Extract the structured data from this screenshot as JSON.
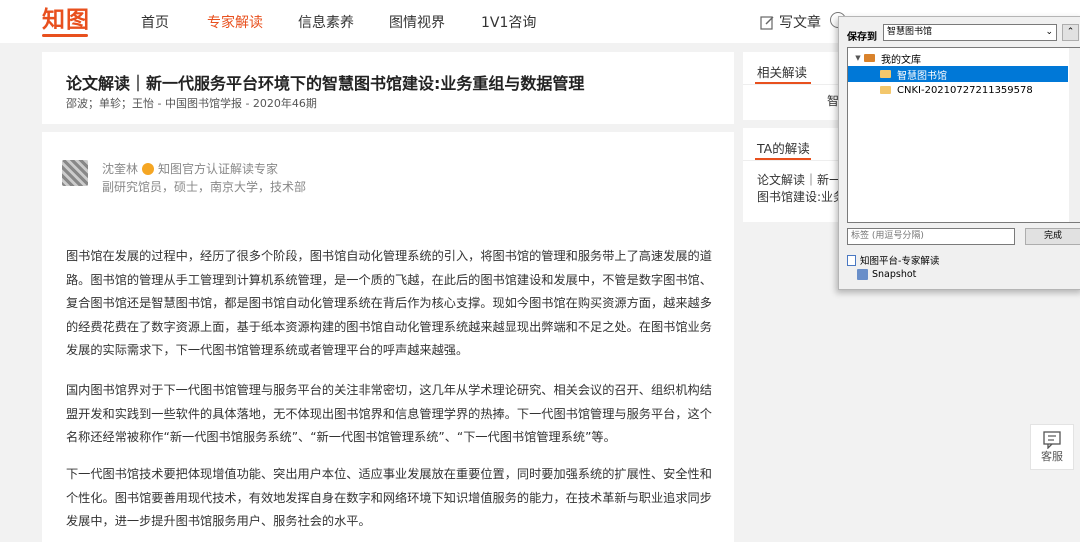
{
  "nav": {
    "logo": "知图",
    "items": [
      "首页",
      "专家解读",
      "信息素养",
      "图情视界",
      "1V1咨询"
    ],
    "active_index": 1,
    "write": "写文章"
  },
  "article": {
    "title": "论文解读｜新一代服务平台环境下的智慧图书馆建设:业务重组与数据管理",
    "meta": "邵波；单轸；王怡 - 中国图书馆学报 - 2020年46期",
    "author_name": "沈奎林",
    "author_badge": "知图官方认证解读专家",
    "author_desc": "副研究馆员，硕士，南京大学，技术部",
    "paragraphs": [
      "图书馆在发展的过程中，经历了很多个阶段，图书馆自动化管理系统的引入，将图书馆的管理和服务带上了高速发展的道路。图书馆的管理从手工管理到计算机系统管理，是一个质的飞越，在此后的图书馆建设和发展中，不管是数字图书馆、复合图书馆还是智慧图书馆，都是图书馆自动化管理系统在背后作为核心支撑。现如今图书馆在购买资源方面，越来越多的经费花费在了数字资源上面，基于纸本资源构建的图书馆自动化管理系统越来越显现出弊端和不足之处。在图书馆业务发展的实际需求下，下一代图书馆管理系统或者管理平台的呼声越来越强。",
      "国内图书馆界对于下一代图书馆管理与服务平台的关注非常密切，这几年从学术理论研究、相关会议的召开、组织机构结盟开发和实践到一些软件的具体落地，无不体现出图书馆界和信息管理学界的热捧。下一代图书馆管理与服务平台，这个名称还经常被称作“新一代图书馆服务系统”、“新一代图书馆管理系统”、“下一代图书馆管理系统”等。",
      "下一代图书馆技术要把体现增值功能、突出用户本位、适应事业发展放在重要位置，同时要加强系统的扩展性、安全性和个性化。图书馆要善用现代技术，有效地发挥自身在数字和网络环境下知识增值服务的能力，在技术革新与职业追求同步发展中，进一步提升图书馆服务用户、服务社会的水平。"
    ]
  },
  "sidebar": {
    "related_title": "相关解读",
    "related_snippet": "智",
    "ta_title": "TA的解读",
    "ta_snippet_1": "论文解读｜新一",
    "ta_snippet_2": "图书馆建设:业务"
  },
  "customer_service": "客服",
  "bookmark_popup": {
    "save_to_label": "保存到",
    "save_to_value": "智慧图书馆",
    "tree": [
      {
        "label": "我的文库",
        "level": 0,
        "selected": false
      },
      {
        "label": "智慧图书馆",
        "level": 1,
        "selected": true
      },
      {
        "label": "CNKI-20210727211359578",
        "level": 1,
        "selected": false
      }
    ],
    "tags_placeholder": "标签 (用逗号分隔)",
    "done_label": "完成",
    "list": [
      "知图平台-专家解读",
      "Snapshot"
    ]
  }
}
